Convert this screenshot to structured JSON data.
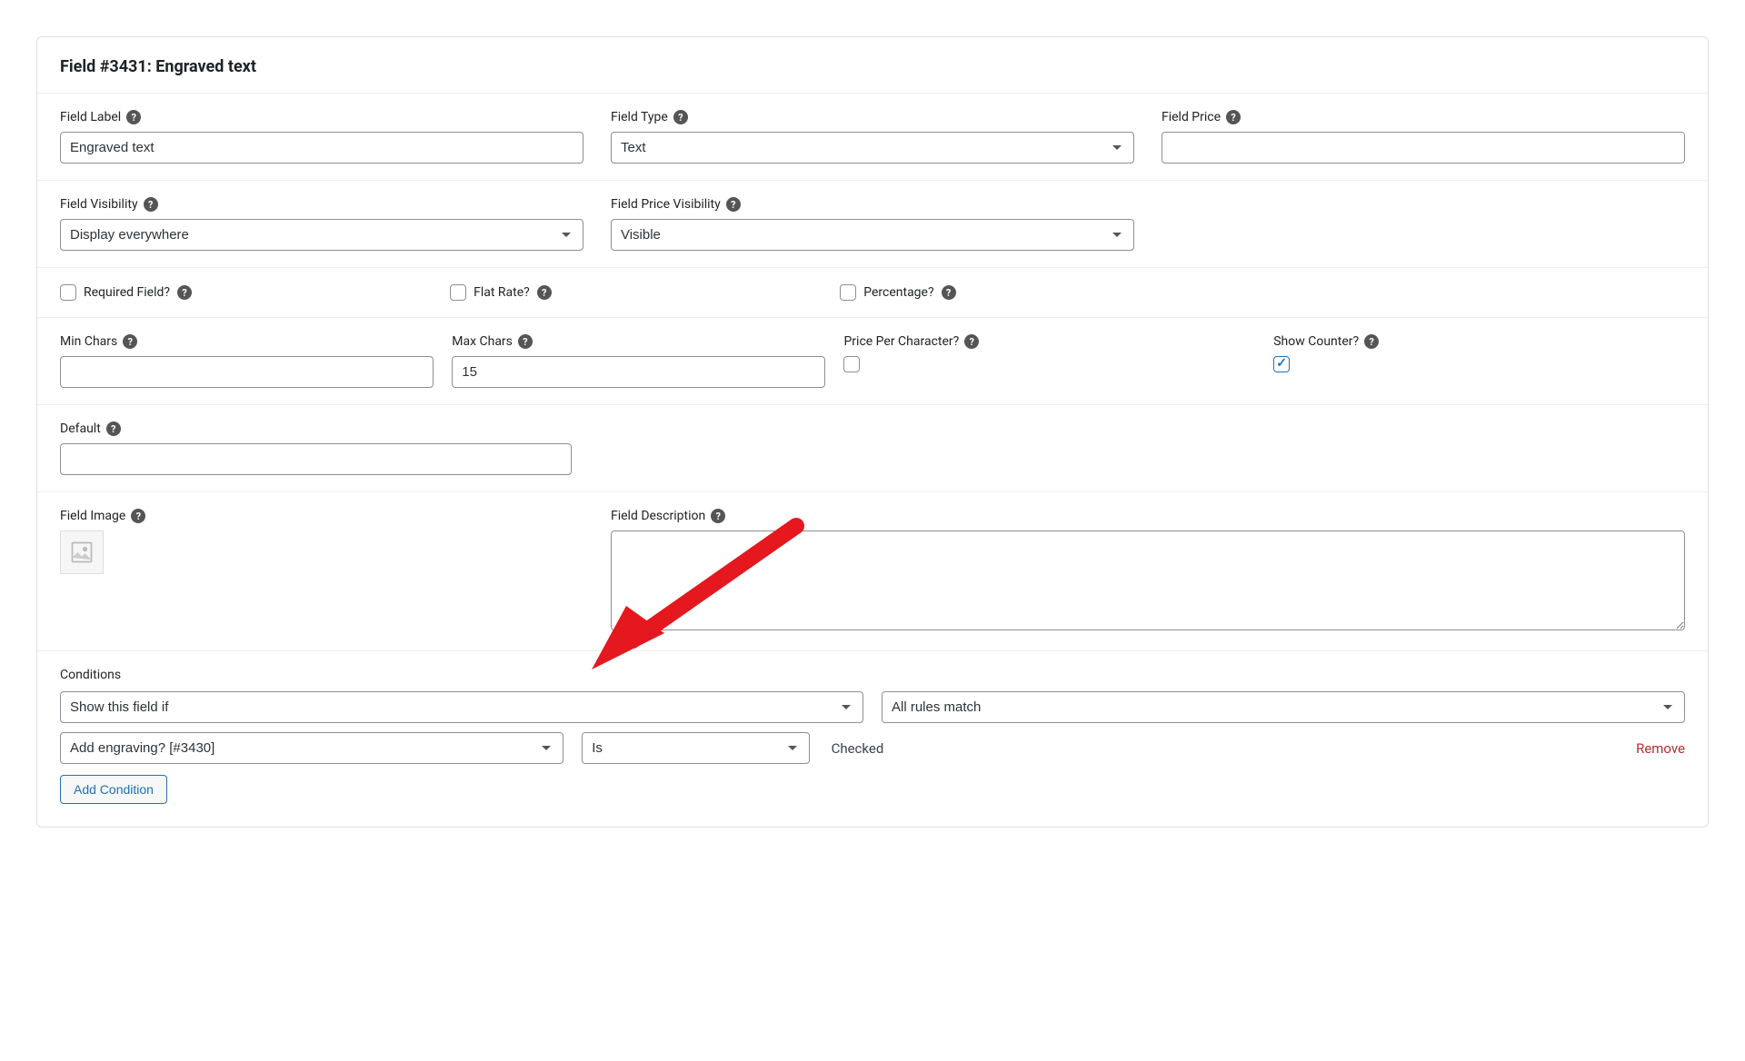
{
  "header": {
    "title": "Field #3431: Engraved text"
  },
  "labels": {
    "field_label": "Field Label",
    "field_type": "Field Type",
    "field_price": "Field Price",
    "field_visibility": "Field Visibility",
    "field_price_visibility": "Field Price Visibility",
    "required": "Required Field?",
    "flat_rate": "Flat Rate?",
    "percentage": "Percentage?",
    "min_chars": "Min Chars",
    "max_chars": "Max Chars",
    "ppc": "Price Per Character?",
    "show_counter": "Show Counter?",
    "default": "Default",
    "field_image": "Field Image",
    "field_description": "Field Description",
    "conditions": "Conditions",
    "remove": "Remove",
    "add_condition": "Add Condition",
    "checked": "Checked"
  },
  "values": {
    "field_label": "Engraved text",
    "field_type": "Text",
    "field_price": "",
    "field_visibility": "Display everywhere",
    "field_price_visibility": "Visible",
    "required": false,
    "flat_rate": false,
    "percentage": false,
    "min_chars": "",
    "max_chars": "15",
    "ppc": false,
    "show_counter": true,
    "default": "",
    "description": "",
    "condition_action": "Show this field if",
    "condition_match": "All rules match",
    "rule_field": "Add engraving? [#3430]",
    "rule_op": "Is"
  }
}
